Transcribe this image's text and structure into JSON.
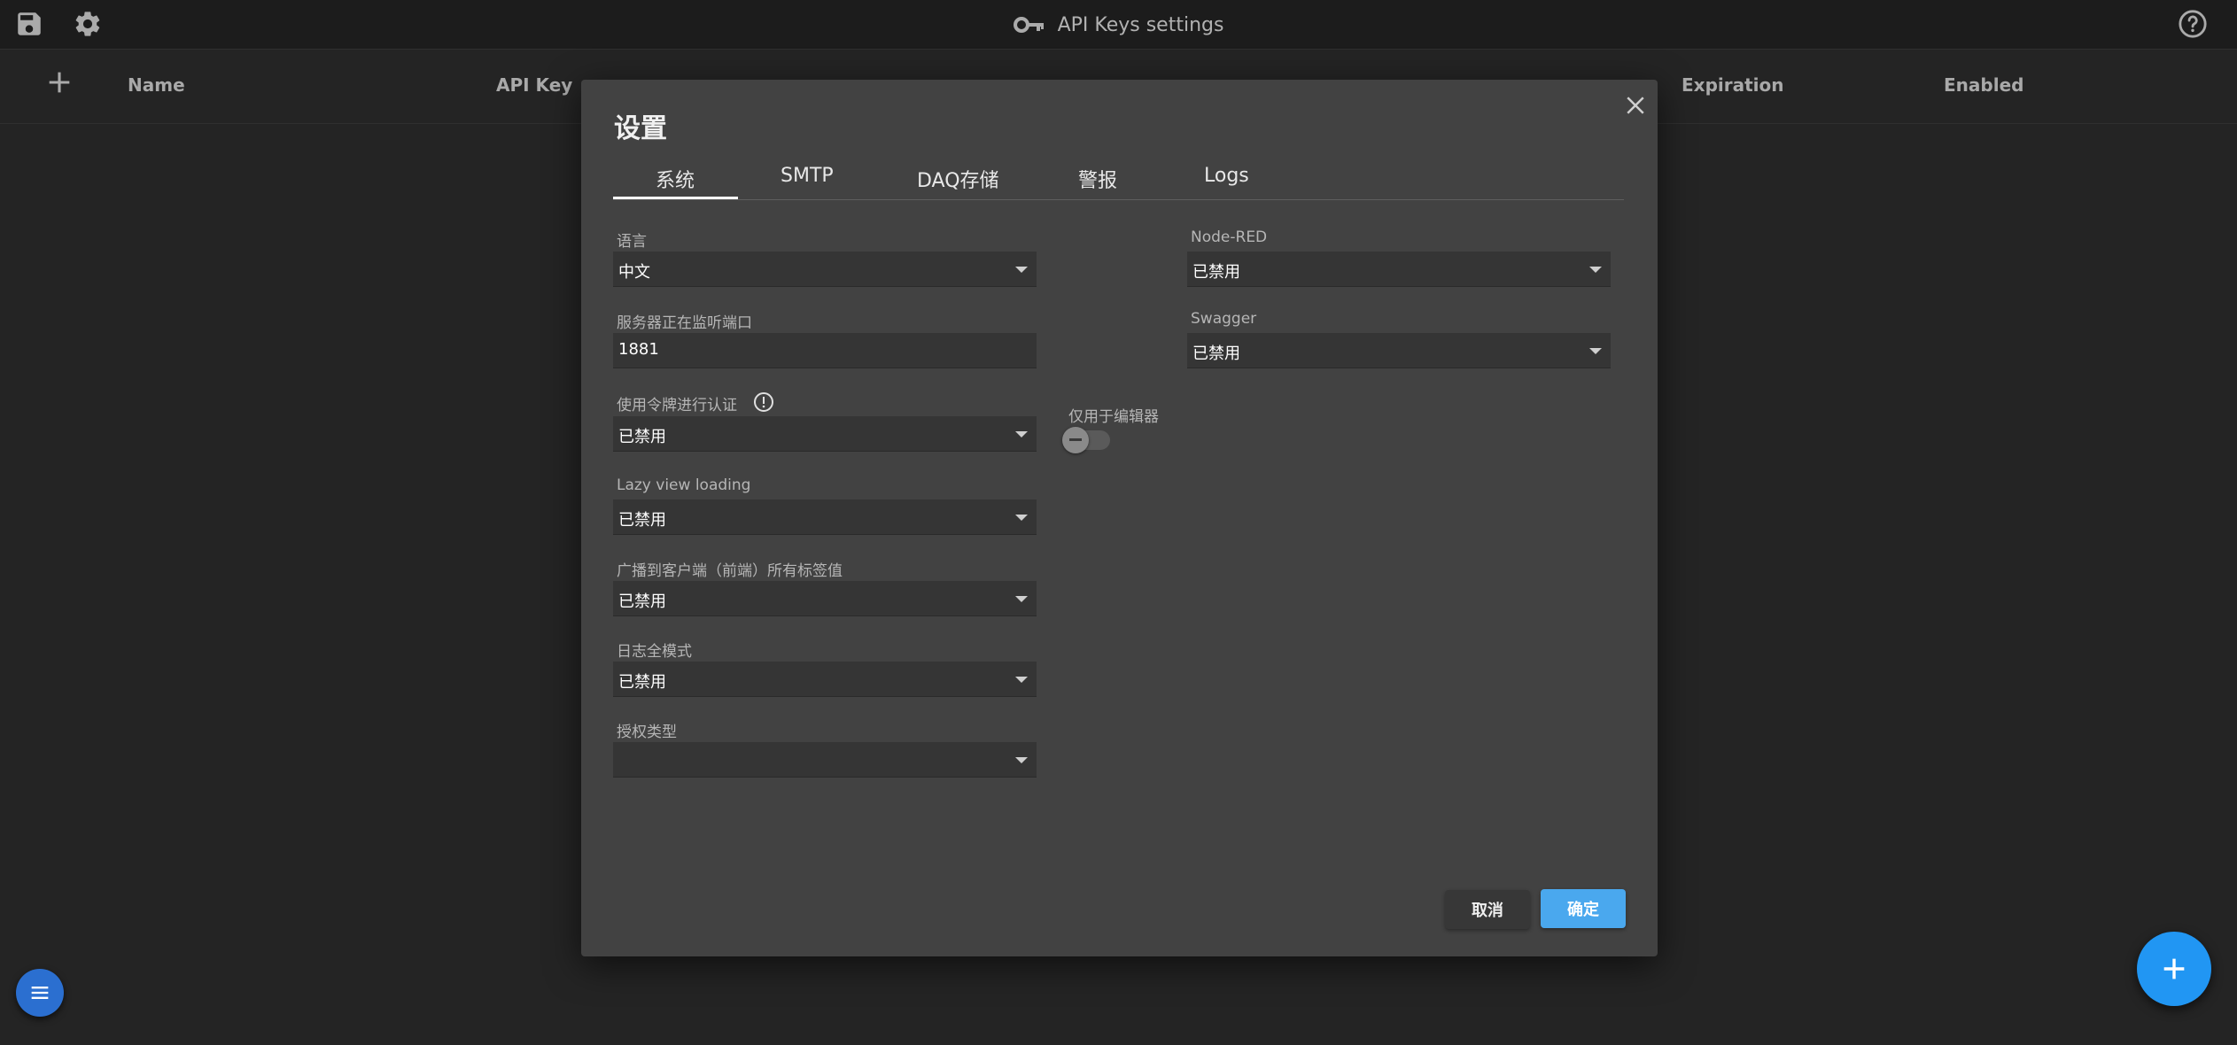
{
  "app": {
    "title": "API Keys settings"
  },
  "topbar": {
    "icons": [
      "save-icon",
      "gear-icon",
      "key-icon",
      "help-icon"
    ]
  },
  "table": {
    "columns": [
      "Name",
      "API Key",
      "Expiration",
      "Enabled"
    ]
  },
  "dialog": {
    "title": "设置",
    "tabs": [
      {
        "label": "系统",
        "active": true
      },
      {
        "label": "SMTP",
        "active": false
      },
      {
        "label": "DAQ存储",
        "active": false
      },
      {
        "label": "警报",
        "active": false
      },
      {
        "label": "Logs",
        "active": false
      }
    ],
    "fields": {
      "language": {
        "label": "语言",
        "value": "中文"
      },
      "port": {
        "label": "服务器正在监听端口",
        "value": "1881"
      },
      "token_auth": {
        "label": "使用令牌进行认证",
        "value": "已禁用"
      },
      "lazy_view": {
        "label": "Lazy view loading",
        "value": "已禁用"
      },
      "broadcast": {
        "label": "广播到客户端（前端）所有标签值",
        "value": "已禁用"
      },
      "log_full": {
        "label": "日志全模式",
        "value": "已禁用"
      },
      "auth_type": {
        "label": "授权类型",
        "value": ""
      },
      "node_red": {
        "label": "Node-RED",
        "value": "已禁用"
      },
      "swagger": {
        "label": "Swagger",
        "value": "已禁用"
      },
      "editor_only": {
        "label": "仅用于编辑器",
        "enabled": false
      }
    },
    "buttons": {
      "cancel": "取消",
      "ok": "确定"
    }
  },
  "colors": {
    "accent": "#4aa8ee",
    "fab": "#2196f3",
    "menu_fab": "#2b6fd0",
    "dialog_bg": "#424242",
    "page_bg": "#2c2c2c"
  }
}
